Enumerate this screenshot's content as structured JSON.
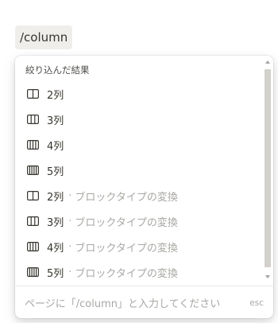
{
  "chip": {
    "text": "/column"
  },
  "menu": {
    "section_header": "絞り込んだ結果",
    "items": [
      {
        "icon": "columns-2-icon",
        "label": "2列",
        "description": ""
      },
      {
        "icon": "columns-3-icon",
        "label": "3列",
        "description": ""
      },
      {
        "icon": "columns-4-icon",
        "label": "4列",
        "description": ""
      },
      {
        "icon": "columns-5-icon",
        "label": "5列",
        "description": ""
      },
      {
        "icon": "columns-2-icon",
        "label": "2列",
        "description": "ブロックタイプの変換"
      },
      {
        "icon": "columns-3-icon",
        "label": "3列",
        "description": "ブロックタイプの変換"
      },
      {
        "icon": "columns-4-icon",
        "label": "4列",
        "description": "ブロックタイプの変換"
      },
      {
        "icon": "columns-5-icon",
        "label": "5列",
        "description": "ブロックタイプの変換"
      }
    ],
    "separator": "·",
    "footer": {
      "hint": "ページに「/column」と入力してください",
      "esc": "esc"
    }
  },
  "colors": {
    "text": "#37352f",
    "muted": "#a8a7a3",
    "chip_bg": "#efeeeb",
    "scroll_thumb": "#d3d1cb"
  }
}
